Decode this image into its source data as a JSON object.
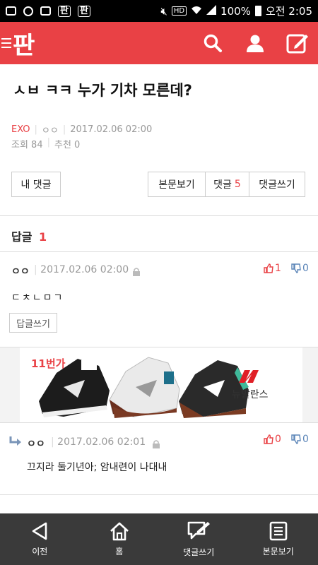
{
  "status_bar": {
    "battery": "100%",
    "time": "오전 2:05",
    "net_badge": "HD",
    "pan_icons": [
      "판",
      "판"
    ]
  },
  "app": {
    "logo": "판",
    "accent_color": "#e94145"
  },
  "post": {
    "title": "ㅅㅂ ㅋㅋ 누가 기차 모른데?",
    "category": "EXO",
    "author": "ㅇㅇ",
    "date": "2017.02.06 02:00",
    "views_label": "조회 84",
    "recommend_label": "추천 0"
  },
  "actions": {
    "my_comments": "내 댓글",
    "view_post": "본문보기",
    "comments_label": "댓글",
    "comments_count": "5",
    "write_comment": "댓글쓰기"
  },
  "replies": {
    "label": "답글",
    "count": "1"
  },
  "comment": {
    "author": "ㅇㅇ",
    "date": "2017.02.06 02:00",
    "up": "1",
    "down": "0",
    "text": "ㄷㅊㄴㅁㄱ",
    "reply_button": "답글쓰기"
  },
  "ad": {
    "shop_badge": "11번가",
    "brand_text": "뉴발란스"
  },
  "reply": {
    "author": "ㅇㅇ",
    "date": "2017.02.06 02:01",
    "up": "0",
    "down": "0",
    "text": "끄지라 둘기년아; 암내련이 나대내"
  },
  "bottom_nav": {
    "items": [
      {
        "label": "이전",
        "icon": "back-icon"
      },
      {
        "label": "홈",
        "icon": "home-icon"
      },
      {
        "label": "댓글쓰기",
        "icon": "write-comment-icon"
      },
      {
        "label": "본문보기",
        "icon": "document-icon"
      }
    ]
  }
}
